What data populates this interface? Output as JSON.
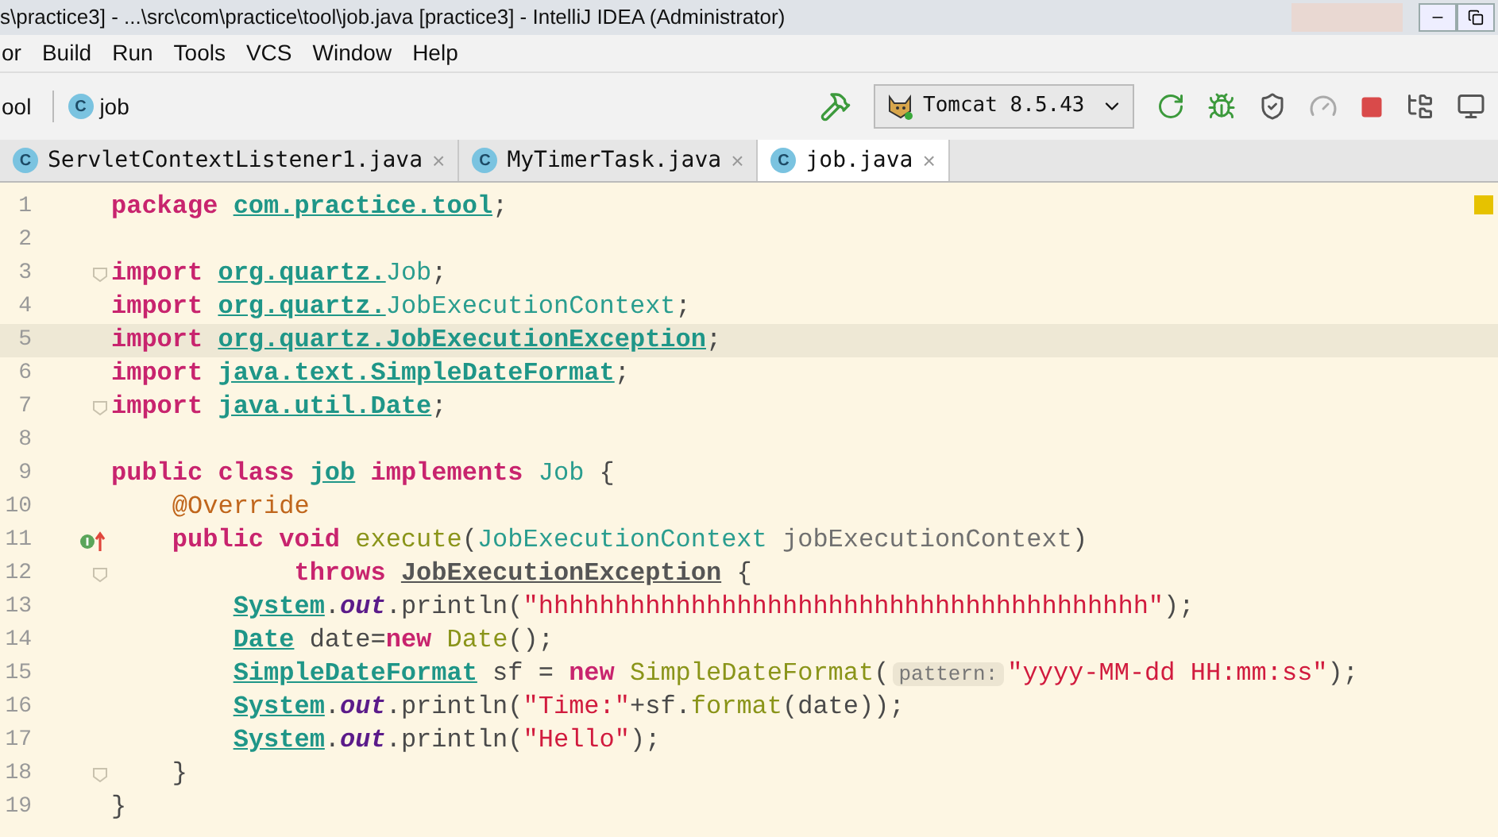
{
  "window": {
    "title": "s\\practice3] - ...\\src\\com\\practice\\tool\\job.java [practice3] - IntelliJ IDEA (Administrator)"
  },
  "menu": [
    "or",
    "Build",
    "Run",
    "Tools",
    "VCS",
    "Window",
    "Help"
  ],
  "breadcrumbs": [
    {
      "label": "ool"
    },
    {
      "label": "job",
      "icon_letter": "C"
    }
  ],
  "run_config": {
    "label": "Tomcat 8.5.43"
  },
  "tabs": [
    {
      "label": "ServletContextListener1.java",
      "icon_letter": "C",
      "close": "×",
      "selected": false
    },
    {
      "label": "MyTimerTask.java",
      "icon_letter": "C",
      "close": "×",
      "selected": false
    },
    {
      "label": "job.java",
      "icon_letter": "C",
      "close": "×",
      "selected": true
    }
  ],
  "editor": {
    "lines": [
      {
        "number": "1",
        "kind": "plain",
        "current": false,
        "tokens": [
          {
            "kind": "keyword",
            "text": "package "
          },
          {
            "kind": "package",
            "text": "com.practice.tool"
          },
          {
            "kind": "plain",
            "text": ";"
          }
        ]
      },
      {
        "number": "2",
        "kind": "plain",
        "current": false
      },
      {
        "number": "3",
        "kind": "fold",
        "current": false,
        "tokens": [
          {
            "kind": "keyword",
            "text": "import "
          },
          {
            "kind": "package",
            "text": "org.quartz."
          },
          {
            "kind": "type",
            "text": "Job"
          },
          {
            "kind": "plain",
            "text": ";"
          }
        ]
      },
      {
        "number": "4",
        "kind": "plain",
        "current": false,
        "tokens": [
          {
            "kind": "keyword",
            "text": "import "
          },
          {
            "kind": "package",
            "text": "org.quartz."
          },
          {
            "kind": "type",
            "text": "JobExecutionContext"
          },
          {
            "kind": "plain",
            "text": ";"
          }
        ]
      },
      {
        "number": "5",
        "kind": "plain",
        "current": true,
        "tokens": [
          {
            "kind": "keyword",
            "text": "import "
          },
          {
            "kind": "package",
            "text": "org.quartz.JobExecutionException"
          },
          {
            "kind": "plain",
            "text": ";"
          }
        ]
      },
      {
        "number": "6",
        "kind": "plain",
        "current": false,
        "tokens": [
          {
            "kind": "keyword",
            "text": "import "
          },
          {
            "kind": "package",
            "text": "java.text.SimpleDateFormat"
          },
          {
            "kind": "plain",
            "text": ";"
          }
        ]
      },
      {
        "number": "7",
        "kind": "fold",
        "current": false,
        "tokens": [
          {
            "kind": "keyword",
            "text": "import "
          },
          {
            "kind": "package",
            "text": "java.util.Date"
          },
          {
            "kind": "plain",
            "text": ";"
          }
        ]
      },
      {
        "number": "8",
        "kind": "plain",
        "current": false
      },
      {
        "number": "9",
        "kind": "plain",
        "current": false,
        "tokens": [
          {
            "kind": "keyword",
            "text": "public class "
          },
          {
            "kind": "package",
            "text": "job"
          },
          {
            "kind": "keyword",
            "text": " implements"
          },
          {
            "kind": "type",
            "text": " Job"
          },
          {
            "kind": "plain",
            "text": " {"
          }
        ]
      },
      {
        "number": "10",
        "kind": "plain",
        "current": false,
        "tokens": [
          {
            "kind": "annotation",
            "text": "    @Override"
          }
        ]
      },
      {
        "number": "11",
        "kind": "override",
        "current": false,
        "tokens": [
          {
            "kind": "keyword",
            "text": "    public void "
          },
          {
            "kind": "method",
            "text": "execute"
          },
          {
            "kind": "plain",
            "text": "("
          },
          {
            "kind": "type",
            "text": "JobExecutionContext"
          },
          {
            "kind": "param",
            "text": " jobExecutionContext"
          },
          {
            "kind": "plain",
            "text": ")"
          }
        ]
      },
      {
        "number": "12",
        "kind": "fold",
        "current": false,
        "tokens": [
          {
            "kind": "keyword",
            "text": "            throws "
          },
          {
            "kind": "ref",
            "text": "JobExecutionException"
          },
          {
            "kind": "plain",
            "text": " {"
          }
        ]
      },
      {
        "number": "13",
        "kind": "plain",
        "current": false,
        "tokens": [
          {
            "kind": "package",
            "text": "        System"
          },
          {
            "kind": "plain",
            "text": "."
          },
          {
            "kind": "static",
            "text": "out"
          },
          {
            "kind": "plain",
            "text": ".println("
          },
          {
            "kind": "string",
            "text": "\"hhhhhhhhhhhhhhhhhhhhhhhhhhhhhhhhhhhhhhhh\""
          },
          {
            "kind": "plain",
            "text": ");"
          }
        ]
      },
      {
        "number": "14",
        "kind": "plain",
        "current": false,
        "tokens": [
          {
            "kind": "package",
            "text": "        Date"
          },
          {
            "kind": "plain",
            "text": " date="
          },
          {
            "kind": "keyword",
            "text": "new"
          },
          {
            "kind": "method",
            "text": " Date"
          },
          {
            "kind": "plain",
            "text": "();"
          }
        ]
      },
      {
        "number": "15",
        "kind": "plain",
        "current": false,
        "tokens": [
          {
            "kind": "package",
            "text": "        SimpleDateFormat"
          },
          {
            "kind": "plain",
            "text": " sf = "
          },
          {
            "kind": "keyword",
            "text": "new"
          },
          {
            "kind": "method",
            "text": " SimpleDateFormat"
          },
          {
            "kind": "plain",
            "text": "("
          },
          {
            "kind": "hint",
            "text": "pattern:"
          },
          {
            "kind": "string",
            "text": "\"yyyy-MM-dd HH:mm:ss\""
          },
          {
            "kind": "plain",
            "text": ");"
          }
        ]
      },
      {
        "number": "16",
        "kind": "plain",
        "current": false,
        "tokens": [
          {
            "kind": "package",
            "text": "        System"
          },
          {
            "kind": "plain",
            "text": "."
          },
          {
            "kind": "static",
            "text": "out"
          },
          {
            "kind": "plain",
            "text": ".println("
          },
          {
            "kind": "string",
            "text": "\"Time:\""
          },
          {
            "kind": "plain",
            "text": "+sf."
          },
          {
            "kind": "method",
            "text": "format"
          },
          {
            "kind": "plain",
            "text": "(date));"
          }
        ]
      },
      {
        "number": "17",
        "kind": "plain",
        "current": false,
        "tokens": [
          {
            "kind": "package",
            "text": "        System"
          },
          {
            "kind": "plain",
            "text": "."
          },
          {
            "kind": "static",
            "text": "out"
          },
          {
            "kind": "plain",
            "text": ".println("
          },
          {
            "kind": "string",
            "text": "\"Hello\""
          },
          {
            "kind": "plain",
            "text": ");"
          }
        ]
      },
      {
        "number": "18",
        "kind": "fold",
        "current": false,
        "tokens": [
          {
            "kind": "plain",
            "text": "    }"
          }
        ]
      },
      {
        "number": "19",
        "kind": "plain",
        "current": false,
        "tokens": [
          {
            "kind": "plain",
            "text": "}"
          }
        ]
      }
    ]
  }
}
